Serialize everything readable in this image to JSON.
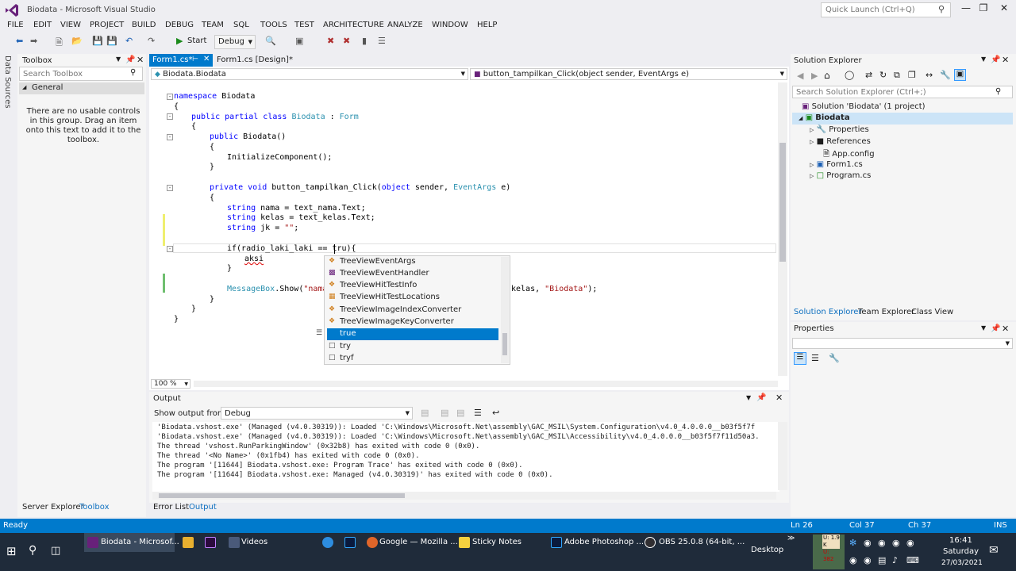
{
  "window": {
    "title": "Biodata - Microsoft Visual Studio",
    "quick_launch_placeholder": "Quick Launch (Ctrl+Q)"
  },
  "menu": [
    "FILE",
    "EDIT",
    "VIEW",
    "PROJECT",
    "BUILD",
    "DEBUG",
    "TEAM",
    "SQL",
    "TOOLS",
    "TEST",
    "ARCHITECTURE",
    "ANALYZE",
    "WINDOW",
    "HELP"
  ],
  "toolbar": {
    "start_label": "Start",
    "config": "Debug"
  },
  "side_strip": {
    "data_sources": "Data Sources"
  },
  "toolbox": {
    "title": "Toolbox",
    "search_placeholder": "Search Toolbox",
    "group": "General",
    "message": "There are no usable controls in this group. Drag an item onto this text to add it to the toolbox."
  },
  "editor": {
    "tabs": [
      "Form1.cs*",
      "Form1.cs [Design]*"
    ],
    "nav_left": "Biodata.Biodata",
    "nav_right": "button_tampilkan_Click(object sender, EventArgs e)",
    "zoom": "100 %",
    "code": {
      "l1_kw": "namespace",
      "l1_rest": " Biodata",
      "l2": "{",
      "l3_kw": "public partial class",
      "l3_name": " Biodata",
      "l3_colon": " : ",
      "l3_base": "Form",
      "l4": "{",
      "l5_kw": "public",
      "l5_rest": " Biodata()",
      "l6": "{",
      "l7": "InitializeComponent();",
      "l8": "}",
      "l9_kw": "private void",
      "l9_name": " button_tampilkan_Click(",
      "l9_kw2": "object",
      "l9_mid": " sender, ",
      "l9_ty": "EventArgs",
      "l9_end": " e)",
      "l10": "{",
      "l11_kw": "string",
      "l11_rest": " nama = text_nama.Text;",
      "l12_kw": "string",
      "l12_rest": " kelas = text_kelas.Text;",
      "l13_kw": "string",
      "l13_rest": " jk = ",
      "l13_str": "\"\"",
      "l13_end": ";",
      "l14": "if(radio_laki_laki == tru){",
      "l15": "aksi",
      "l16": "}",
      "l17_ty": "MessageBox",
      "l17_rest": ".Show(",
      "l17_str": "\"nama",
      "l17_tail": "kelas, ",
      "l17_str2": "\"Biodata\"",
      "l17_end": ");",
      "l18": "}",
      "l19": "}",
      "l20": "}"
    }
  },
  "intellisense": {
    "items": [
      {
        "label": "TreeViewEventArgs",
        "icon": "class-icon"
      },
      {
        "label": "TreeViewEventHandler",
        "icon": "delegate-icon"
      },
      {
        "label": "TreeViewHitTestInfo",
        "icon": "class-icon"
      },
      {
        "label": "TreeViewHitTestLocations",
        "icon": "enum-icon"
      },
      {
        "label": "TreeViewImageIndexConverter",
        "icon": "class-icon"
      },
      {
        "label": "TreeViewImageKeyConverter",
        "icon": "class-icon"
      },
      {
        "label": "true",
        "icon": "keyword-icon"
      },
      {
        "label": "try",
        "icon": "snippet-icon"
      },
      {
        "label": "tryf",
        "icon": "snippet-icon"
      }
    ],
    "selected": "true"
  },
  "output": {
    "title": "Output",
    "show_from_label": "Show output from:",
    "show_from_value": "Debug",
    "lines": [
      "'Biodata.vshost.exe' (Managed (v4.0.30319)): Loaded 'C:\\Windows\\Microsoft.Net\\assembly\\GAC_MSIL\\System.Configuration\\v4.0_4.0.0.0__b03f5f7f",
      "'Biodata.vshost.exe' (Managed (v4.0.30319)): Loaded 'C:\\Windows\\Microsoft.Net\\assembly\\GAC_MSIL\\Accessibility\\v4.0_4.0.0.0__b03f5f7f11d50a3.",
      "The thread 'vshost.RunParkingWindow' (0x32b8) has exited with code 0 (0x0).",
      "The thread '<No Name>' (0x1fb4) has exited with code 0 (0x0).",
      "The program '[11644] Biodata.vshost.exe: Program Trace' has exited with code 0 (0x0).",
      "The program '[11644] Biodata.vshost.exe: Managed (v4.0.30319)' has exited with code 0 (0x0)."
    ]
  },
  "bottom_tabs": {
    "left": [
      "Server Explorer",
      "Toolbox"
    ],
    "mid": [
      "Error List",
      "Output"
    ]
  },
  "solution_explorer": {
    "title": "Solution Explorer",
    "search_placeholder": "Search Solution Explorer (Ctrl+;)",
    "solution": "Solution 'Biodata' (1 project)",
    "project": "Biodata",
    "items": [
      "Properties",
      "References",
      "App.config",
      "Form1.cs",
      "Program.cs"
    ],
    "tabs": [
      "Solution Explorer",
      "Team Explorer",
      "Class View"
    ]
  },
  "properties": {
    "title": "Properties"
  },
  "status": {
    "ready": "Ready",
    "ln": "Ln 26",
    "col": "Col 37",
    "ch": "Ch 37",
    "ins": "INS"
  },
  "taskbar": {
    "apps": [
      "Biodata - Microsof...",
      "Videos",
      "Google — Mozilla ...",
      "Sticky Notes",
      "Adobe Photoshop ...",
      "OBS 25.0.8 (64-bit, ..."
    ],
    "desktop": "Desktop",
    "monitor": {
      "up": "U: 1.9 K",
      "down": "U: 382"
    },
    "time": "16:41",
    "day": "Saturday",
    "date": "27/03/2021"
  },
  "colors": {
    "accent": "#007acc",
    "keyword": "#0000ff",
    "type": "#2b91af",
    "string": "#a31515"
  }
}
